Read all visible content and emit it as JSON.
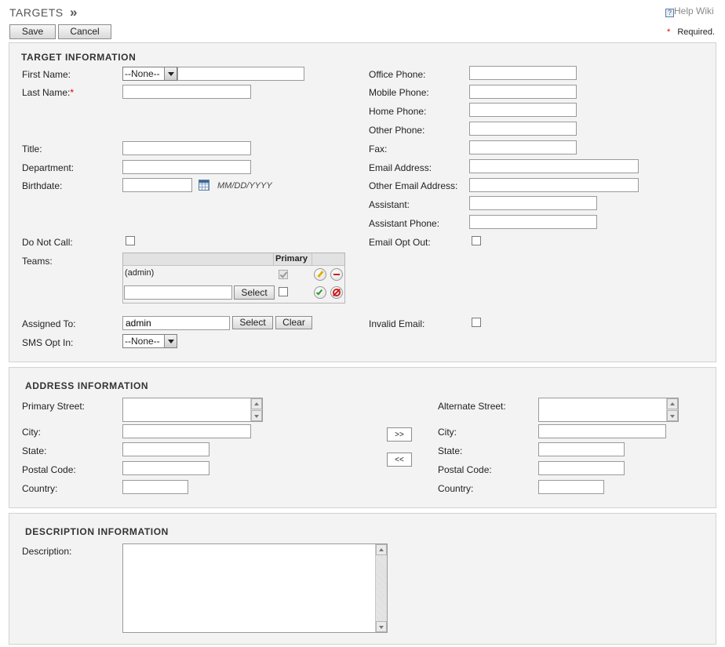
{
  "header": {
    "title": "TARGETS",
    "title_arrow": "»",
    "help_link": "Help Wiki",
    "required_marker": "*",
    "required_label": "Required."
  },
  "toolbar": {
    "save_label": "Save",
    "cancel_label": "Cancel"
  },
  "target_info": {
    "title": "TARGET INFORMATION",
    "first_name": {
      "label": "First Name:",
      "salutation": "--None--",
      "value": ""
    },
    "last_name": {
      "label": "Last Name:",
      "required_mark": "*",
      "value": ""
    },
    "title_field": {
      "label": "Title:",
      "value": ""
    },
    "department": {
      "label": "Department:",
      "value": ""
    },
    "birthdate": {
      "label": "Birthdate:",
      "value": "",
      "format_hint": "MM/DD/YYYY"
    },
    "do_not_call": {
      "label": "Do Not Call:",
      "checked": false
    },
    "teams": {
      "label": "Teams:",
      "header_primary": "Primary",
      "rows": [
        {
          "name": "(admin)",
          "primary": true
        }
      ],
      "new_value": "",
      "select_label": "Select"
    },
    "assigned_to": {
      "label": "Assigned To:",
      "value": "admin",
      "select_label": "Select",
      "clear_label": "Clear"
    },
    "sms_opt_in": {
      "label": "SMS Opt In:",
      "value": "--None--"
    },
    "office_phone": {
      "label": "Office Phone:",
      "value": ""
    },
    "mobile_phone": {
      "label": "Mobile Phone:",
      "value": ""
    },
    "home_phone": {
      "label": "Home Phone:",
      "value": ""
    },
    "other_phone": {
      "label": "Other Phone:",
      "value": ""
    },
    "fax": {
      "label": "Fax:",
      "value": ""
    },
    "email_address": {
      "label": "Email Address:",
      "value": ""
    },
    "other_email_address": {
      "label": "Other Email Address:",
      "value": ""
    },
    "assistant": {
      "label": "Assistant:",
      "value": ""
    },
    "assistant_phone": {
      "label": "Assistant Phone:",
      "value": ""
    },
    "email_opt_out": {
      "label": "Email Opt Out:",
      "checked": false
    },
    "invalid_email": {
      "label": "Invalid Email:",
      "checked": false
    }
  },
  "address_info": {
    "title": "ADDRESS INFORMATION",
    "primary": {
      "street_label": "Primary Street:",
      "city_label": "City:",
      "state_label": "State:",
      "postal_label": "Postal Code:",
      "country_label": "Country:"
    },
    "alternate": {
      "street_label": "Alternate Street:",
      "city_label": "City:",
      "state_label": "State:",
      "postal_label": "Postal Code:",
      "country_label": "Country:"
    },
    "copy_right_label": ">>",
    "copy_left_label": "<<"
  },
  "description_info": {
    "title": "DESCRIPTION INFORMATION",
    "label": "Description:",
    "value": ""
  },
  "colors": {
    "required": "#e00000",
    "section_bg": "#f3f3f3",
    "confirm_green": "#2e9c2e",
    "remove_red": "#cc1f1f"
  }
}
